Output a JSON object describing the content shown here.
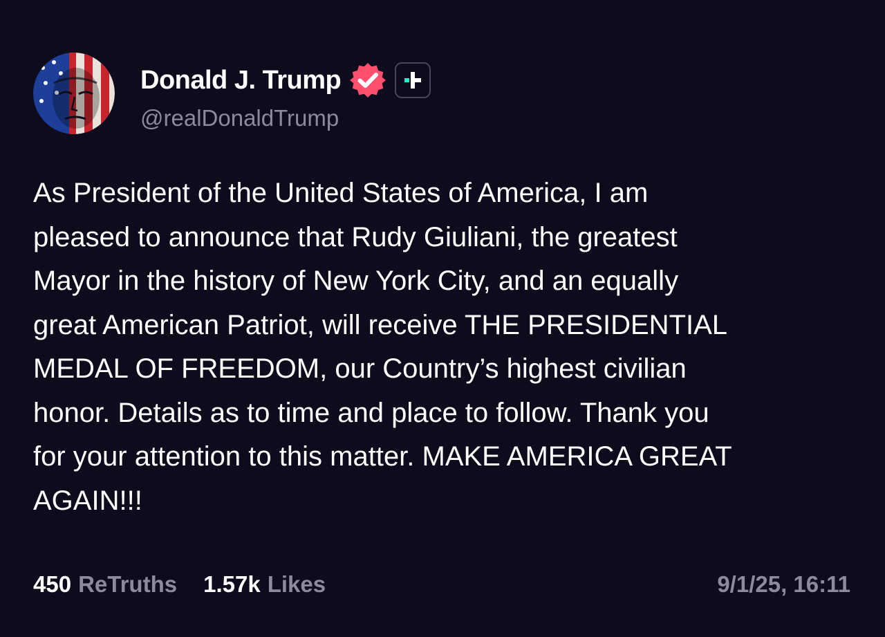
{
  "author": {
    "display_name": "Donald J. Trump",
    "handle": "@realDonaldTrump",
    "verified_icon": "verified-badge-icon",
    "plus_icon": "plus-icon"
  },
  "post": {
    "text": "As President of the United States of America, I am\npleased to announce that Rudy Giuliani, the greatest\nMayor in the history of New York City, and an equally\ngreat American Patriot, will receive THE PRESIDENTIAL\nMEDAL OF FREEDOM, our Country’s highest civilian\nhonor. Details as to time and place to follow. Thank you\nfor your attention to this matter. MAKE AMERICA GREAT\nAGAIN!!!",
    "timestamp": "9/1/25, 16:11"
  },
  "stats": {
    "retruths_count": "450",
    "retruths_label": "ReTruths",
    "likes_count": "1.57k",
    "likes_label": "Likes"
  },
  "colors": {
    "background": "#0d0b1c",
    "text": "#ffffff",
    "muted": "#8c8a9b",
    "verified": "#ff4f6e",
    "accent": "#2ee6c8"
  }
}
